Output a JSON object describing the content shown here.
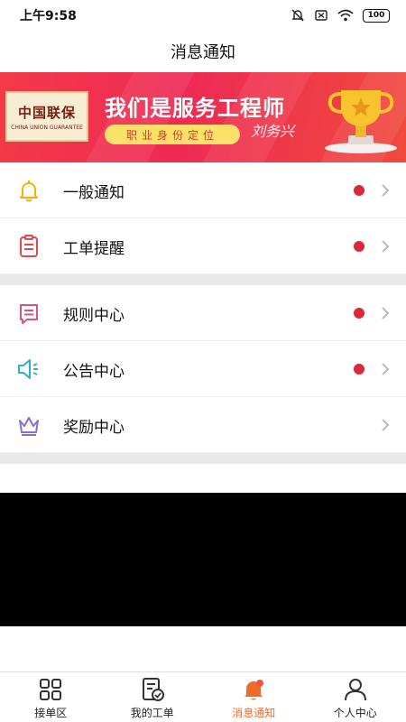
{
  "status_bar": {
    "time": "上午9:58",
    "battery": "100"
  },
  "header": {
    "title": "消息通知"
  },
  "banner": {
    "logo_text": "中国联保",
    "logo_sub": "CHINA UNION GUARANTEE",
    "title": "我们是服务工程师",
    "pill": "职业身份定位",
    "signature": "刘务兴"
  },
  "group1": [
    {
      "label": "一般通知",
      "icon": "bell-icon",
      "unread": true
    },
    {
      "label": "工单提醒",
      "icon": "clipboard-icon",
      "unread": true
    }
  ],
  "group2": [
    {
      "label": "规则中心",
      "icon": "book-icon",
      "unread": true
    },
    {
      "label": "公告中心",
      "icon": "speaker-icon",
      "unread": true
    },
    {
      "label": "奖励中心",
      "icon": "crown-icon",
      "unread": false
    }
  ],
  "tabs": [
    {
      "label": "接单区",
      "icon": "grid-icon",
      "active": false
    },
    {
      "label": "我的工单",
      "icon": "order-check-icon",
      "active": false
    },
    {
      "label": "消息通知",
      "icon": "bell-filled-icon",
      "active": true
    },
    {
      "label": "个人中心",
      "icon": "person-icon",
      "active": false
    }
  ],
  "colors": {
    "accent": "#ef6a2a",
    "unread_dot": "#d8283a",
    "banner": "#f03a4c"
  }
}
